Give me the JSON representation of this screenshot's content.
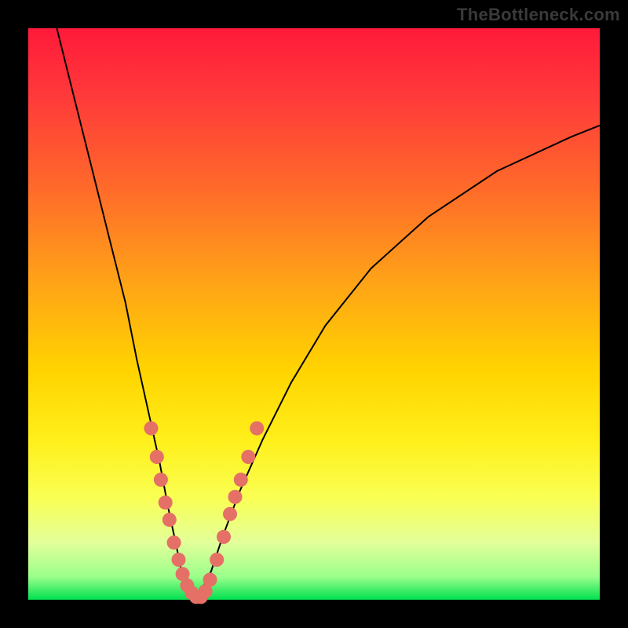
{
  "watermark": "TheBottleneck.com",
  "chart_data": {
    "type": "line",
    "title": "",
    "xlabel": "",
    "ylabel": "",
    "xlim": [
      0,
      100
    ],
    "ylim": [
      0,
      100
    ],
    "background": "rainbow-red-to-green-vertical",
    "series": [
      {
        "name": "bottleneck-curve",
        "x": [
          5,
          8,
          11,
          14,
          17,
          19,
          21,
          23,
          24.5,
          26,
          27,
          28,
          29,
          30,
          32,
          34,
          37,
          41,
          46,
          52,
          60,
          70,
          82,
          95,
          100
        ],
        "y": [
          100,
          88,
          76,
          64,
          52,
          42,
          33,
          24,
          16,
          9,
          4,
          1,
          0,
          1,
          5,
          11,
          19,
          28,
          38,
          48,
          58,
          67,
          75,
          81,
          83
        ]
      }
    ],
    "markers": {
      "name": "highlight-dots",
      "color": "#e47066",
      "points": [
        {
          "x": 21.5,
          "y": 30
        },
        {
          "x": 22.5,
          "y": 25
        },
        {
          "x": 23.2,
          "y": 21
        },
        {
          "x": 24.0,
          "y": 17
        },
        {
          "x": 24.7,
          "y": 14
        },
        {
          "x": 25.5,
          "y": 10
        },
        {
          "x": 26.3,
          "y": 7
        },
        {
          "x": 27.0,
          "y": 4.5
        },
        {
          "x": 27.8,
          "y": 2.5
        },
        {
          "x": 28.6,
          "y": 1.2
        },
        {
          "x": 29.4,
          "y": 0.5
        },
        {
          "x": 30.2,
          "y": 0.5
        },
        {
          "x": 31.0,
          "y": 1.5
        },
        {
          "x": 31.8,
          "y": 3.5
        },
        {
          "x": 33.0,
          "y": 7
        },
        {
          "x": 34.2,
          "y": 11
        },
        {
          "x": 35.3,
          "y": 15
        },
        {
          "x": 36.2,
          "y": 18
        },
        {
          "x": 37.2,
          "y": 21
        },
        {
          "x": 38.5,
          "y": 25
        },
        {
          "x": 40.0,
          "y": 30
        }
      ]
    }
  }
}
